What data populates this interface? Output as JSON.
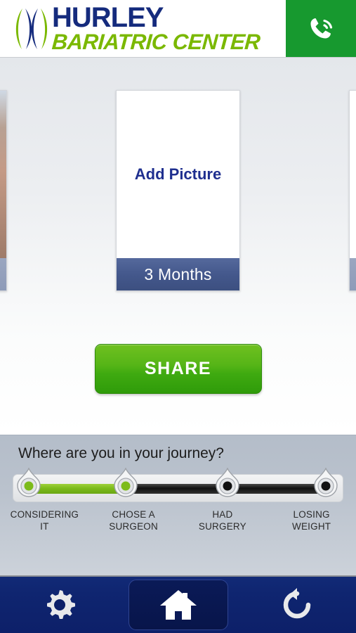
{
  "header": {
    "logo_line1": "HURLEY",
    "logo_line2": "BARIATRIC CENTER",
    "logo_mark_name": "hurley-lens-logo",
    "call_icon": "phone-call-icon",
    "brand_navy": "#152b7d",
    "brand_green": "#7ab800",
    "call_button_green": "#17992f"
  },
  "main": {
    "card": {
      "add_picture_label": "Add Picture",
      "footer_label": "3 Months"
    },
    "share_button_label": "SHARE",
    "share_button_color": "#3faa10"
  },
  "journey": {
    "title": "Where are you in your journey?",
    "stages": [
      {
        "label_line1": "CONSIDERING",
        "label_line2": "IT",
        "state": "complete"
      },
      {
        "label_line1": "CHOSE A",
        "label_line2": "SURGEON",
        "state": "complete"
      },
      {
        "label_line1": "HAD",
        "label_line2": "SURGERY",
        "state": "incomplete"
      },
      {
        "label_line1": "LOSING",
        "label_line2": "WEIGHT",
        "state": "incomplete"
      }
    ],
    "handle_icon": "teardrop-slider-handle",
    "active_color": "#7cbb1b",
    "inactive_color": "#111111"
  },
  "navbar": {
    "items": [
      {
        "icon": "gear-icon",
        "name": "settings",
        "active": false
      },
      {
        "icon": "home-icon",
        "name": "home",
        "active": true
      },
      {
        "icon": "refresh-icon",
        "name": "refresh",
        "active": false
      }
    ]
  }
}
